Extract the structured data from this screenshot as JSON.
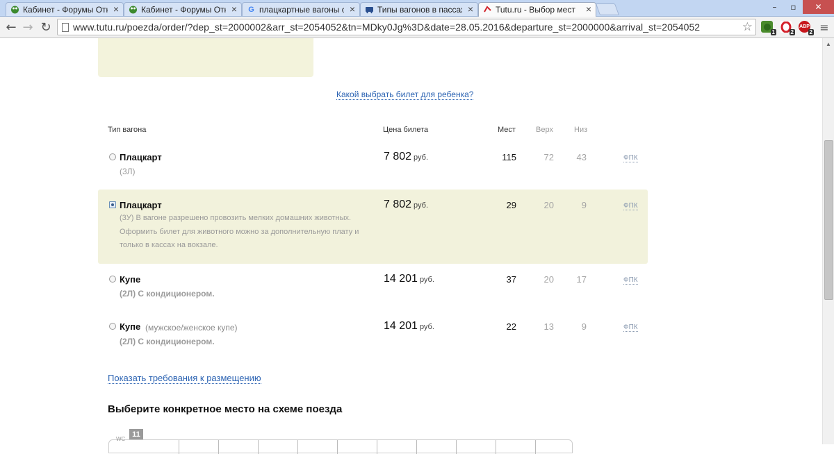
{
  "browser": {
    "tabs": [
      {
        "title": "Кабинет - Форумы Откр",
        "icon": "green-frog-icon",
        "active": false
      },
      {
        "title": "Кабинет - Форумы Откр",
        "icon": "green-frog-icon",
        "active": false
      },
      {
        "title": "плацкартные вагоны с м",
        "icon": "google-icon",
        "active": false
      },
      {
        "title": "Типы вагонов в пассаж",
        "icon": "train-icon",
        "active": false
      },
      {
        "title": "Tutu.ru - Выбор мест",
        "icon": "tutu-icon",
        "active": true
      }
    ],
    "address": "www.tutu.ru/poezda/order/?dep_st=2000002&arr_st=2054052&tn=MDky0Jg%3D&date=28.05.2016&departure_st=2000000&arrival_st=2054052",
    "extensions": [
      {
        "name": "frog-extension",
        "badge": "1",
        "color": "#4a8b2c"
      },
      {
        "name": "opera-extension",
        "badge": "2",
        "color": "#d4202a"
      },
      {
        "name": "adblock-extension",
        "label": "ABP",
        "badge": "2",
        "color": "#c7161c"
      }
    ]
  },
  "page": {
    "child_ticket_link": "Какой выбрать билет для ребенка?",
    "headers": {
      "type": "Тип вагона",
      "price": "Цена билета",
      "seats": "Мест",
      "upper": "Верх",
      "lower": "Низ"
    },
    "currency": "руб.",
    "carriages": [
      {
        "name": "Плацкарт",
        "note": "",
        "class": "(3Л)",
        "desc": "",
        "price": "7 802",
        "seats": "115",
        "upper": "72",
        "lower": "43",
        "carrier": "ФПК",
        "selected": false
      },
      {
        "name": "Плацкарт",
        "note": "",
        "class": "",
        "desc": "(3У) В вагоне разрешено провозить мелких домашних животных. Оформить билет для животного можно за дополнительную плату и только в кассах на вокзале.",
        "price": "7 802",
        "seats": "29",
        "upper": "20",
        "lower": "9",
        "carrier": "ФПК",
        "selected": true
      },
      {
        "name": "Купе",
        "note": "",
        "class": "(2Л) С кондиционером.",
        "desc": "",
        "price": "14 201",
        "seats": "37",
        "upper": "20",
        "lower": "17",
        "carrier": "ФПК",
        "selected": false
      },
      {
        "name": "Купе",
        "note": "(мужское/женское купе)",
        "class": "(2Л) С кондиционером.",
        "desc": "",
        "price": "14 201",
        "seats": "22",
        "upper": "13",
        "lower": "9",
        "carrier": "ФПК",
        "selected": false
      }
    ],
    "requirements_link": "Показать требования к размещению",
    "choose_seat_title": "Выберите конкретное место на схеме поезда",
    "wagon_number": "11",
    "scheme_label": "WC"
  }
}
